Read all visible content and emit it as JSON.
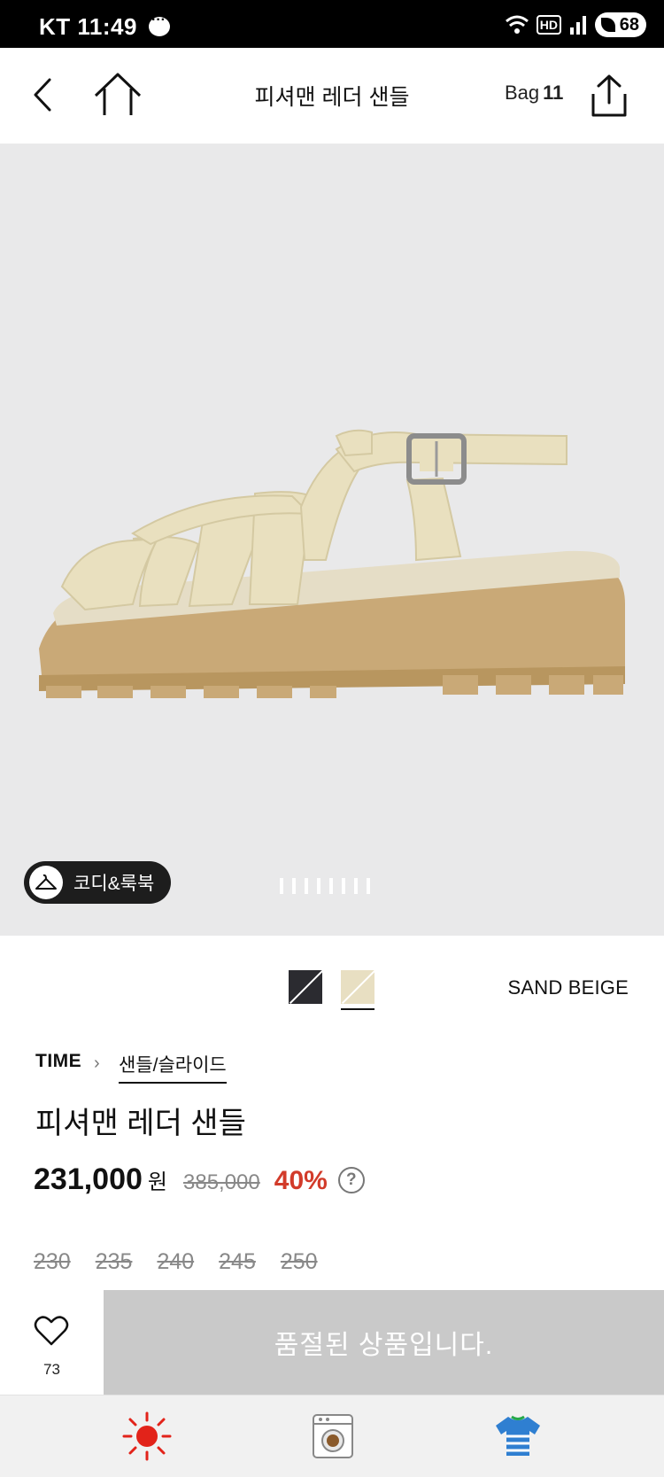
{
  "status_bar": {
    "carrier_time": "KT 11:49",
    "network": "HD",
    "battery": "68"
  },
  "header": {
    "title": "피셔맨 레더 샌들",
    "bag_label": "Bag",
    "bag_count": "11"
  },
  "hero": {
    "coordi_label": "코디&룩북",
    "slide_count": 8
  },
  "colors": {
    "selected_name": "SAND BEIGE",
    "options": [
      {
        "name": "black",
        "hex": "#2b2b30"
      },
      {
        "name": "sand beige",
        "hex": "#e8dfc2",
        "selected": true
      }
    ]
  },
  "product": {
    "brand": "TIME",
    "category": "샌들/슬라이드",
    "name": "피셔맨 레더 샌들",
    "price": "231,000",
    "currency": "원",
    "original_price": "385,000",
    "discount": "40%",
    "help": "?"
  },
  "sizes": [
    "230",
    "235",
    "240",
    "245",
    "250"
  ],
  "actions": {
    "wish_count": "73",
    "soldout_label": "품절된 상품입니다."
  },
  "tray": {
    "icons": [
      "sun-icon",
      "washing-machine-icon",
      "shirt-icon"
    ]
  },
  "accent_colors": {
    "discount": "#d23b2a",
    "soldout_bg": "#c9c9c9"
  }
}
